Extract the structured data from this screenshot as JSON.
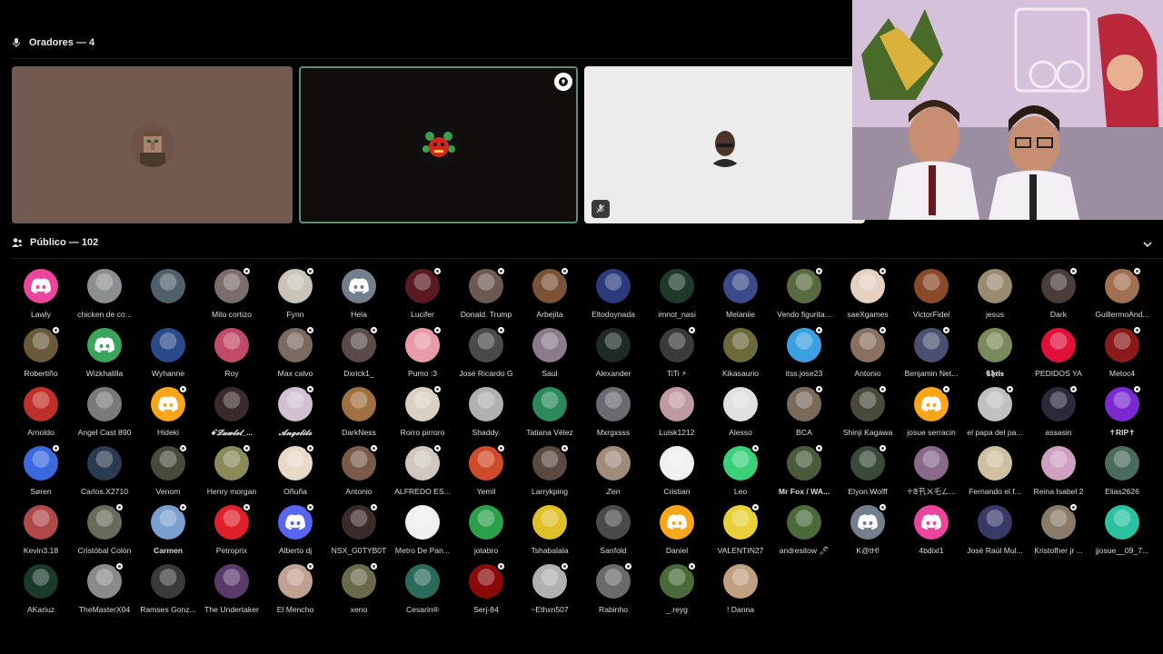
{
  "speakers": {
    "title": "Oradores — 4",
    "icon": "microphone-icon"
  },
  "audience": {
    "title": "Público — 102",
    "icon": "audience-icon",
    "collapse_icon": "chevron-down-icon"
  },
  "tiles": [
    {
      "id": "tile1",
      "avatar": "villager",
      "speaking": false,
      "moderator": false,
      "muted": false
    },
    {
      "id": "tile2",
      "avatar": "red-creature",
      "speaking": true,
      "moderator": true,
      "muted": false
    },
    {
      "id": "tile3",
      "avatar": "portrait",
      "speaking": false,
      "moderator": false,
      "muted": true
    }
  ],
  "colors": {
    "discord_pink": "#eb459e",
    "discord_green": "#3ba55c",
    "discord_orange": "#faa61a",
    "discord_gray": "#747f8d",
    "discord_blurple": "#5865f2",
    "speaking_border": "#5b8f6e"
  },
  "members": [
    [
      {
        "name": "Lawly",
        "color": "#eb459e",
        "type": "discord"
      },
      {
        "name": "chicken de co...",
        "color": "#8b8f90"
      },
      {
        "name": "",
        "color": "#50606a"
      },
      {
        "name": "Mito cortizo",
        "color": "#7a6d6b",
        "badge": true
      },
      {
        "name": "Fynn",
        "color": "#c9c3b8",
        "badge": true
      },
      {
        "name": "Hela",
        "color": "#747f8d",
        "type": "discord"
      },
      {
        "name": "Lucifer",
        "color": "#5a1a22",
        "badge": true
      },
      {
        "name": "Donald. Trump",
        "color": "#6c5a52",
        "badge": true
      },
      {
        "name": "Arbejita",
        "color": "#7b5238",
        "badge": true
      },
      {
        "name": "Eltodoynada",
        "color": "#2a3a7a"
      },
      {
        "name": "imnot_nasi",
        "color": "#1f3a28"
      },
      {
        "name": "Melaniie",
        "color": "#3a4a8a"
      },
      {
        "name": "Vendo figurita...",
        "color": "#5a6a40",
        "badge": true
      },
      {
        "name": "saeXgames",
        "color": "#e7d0c0",
        "badge": true
      },
      {
        "name": "VictorFidel",
        "color": "#8a4a2a"
      },
      {
        "name": "jesus",
        "color": "#9a8a70"
      },
      {
        "name": "Dark",
        "color": "#4a3c38",
        "badge": true
      },
      {
        "name": "GuillermoAnd...",
        "color": "#a07050",
        "badge": true
      }
    ],
    [
      {
        "name": "Robertiño",
        "color": "#6a5a3a",
        "badge": true
      },
      {
        "name": "Wizkhalilla",
        "color": "#3ba55c",
        "type": "discord"
      },
      {
        "name": "Wyhanne",
        "color": "#2a4a8a"
      },
      {
        "name": "Roy",
        "color": "#c04a6a"
      },
      {
        "name": "Max calvo",
        "color": "#7a6a60",
        "badge": true
      },
      {
        "name": "Dxrick1_",
        "color": "#5a4a4a",
        "badge": true
      },
      {
        "name": "Pumo :3",
        "color": "#e89aa8",
        "badge": true
      },
      {
        "name": "José Ricardo G",
        "color": "#4a4a4a",
        "badge": true
      },
      {
        "name": "Saul",
        "color": "#8a7a8a"
      },
      {
        "name": "Alexander",
        "color": "#1e2a24"
      },
      {
        "name": "TiTi ⚡",
        "color": "#3a3a3a",
        "badge": true
      },
      {
        "name": "Kikasaurio",
        "color": "#6a6a3a"
      },
      {
        "name": "itss.jose23",
        "color": "#3aa0e0",
        "badge": true
      },
      {
        "name": "Antonio",
        "color": "#8a7060",
        "badge": true
      },
      {
        "name": "Benjamin Net...",
        "color": "#4a5070",
        "badge": true
      },
      {
        "name": "𝕮𝖍𝖗𝖎𝖘",
        "color": "#7a8a5a",
        "style": "b"
      },
      {
        "name": "PEDIDOS YA",
        "color": "#e0103a"
      },
      {
        "name": "Metoc4",
        "color": "#8a1a1a",
        "badge": true
      }
    ],
    [
      {
        "name": "Arnoldo",
        "color": "#c0302a"
      },
      {
        "name": "Angel Cast 890",
        "color": "#7a7a7a"
      },
      {
        "name": "Hideki",
        "color": "#faa61a",
        "type": "discord",
        "badge": true
      },
      {
        "name": "ꗃ𝓛𝓪𝔀𝓵𝓮𝓽_...",
        "color": "#3a2a2a",
        "style": "bi"
      },
      {
        "name": "𝓐𝓷𝓰𝓮𝓵𝓲𝓽𝓸",
        "color": "#d0c0d0",
        "style": "bi",
        "badge": true
      },
      {
        "name": "DarkNess",
        "color": "#a07040"
      },
      {
        "name": "Rorro pirroro",
        "color": "#d8d0c0",
        "badge": true
      },
      {
        "name": "Shaddy.",
        "color": "#b0b0b0"
      },
      {
        "name": "Tatiana Vélez",
        "color": "#2a8a5a"
      },
      {
        "name": "Mxrgxsss",
        "color": "#6a6a70"
      },
      {
        "name": "Luisk1212",
        "color": "#c09aa0"
      },
      {
        "name": "Alesso",
        "color": "#e0e0e0"
      },
      {
        "name": "BCA",
        "color": "#7a6a5a",
        "badge": true
      },
      {
        "name": "Shinji Kagawa",
        "color": "#4a4a3a",
        "badge": true
      },
      {
        "name": "josue serracin",
        "color": "#faa61a",
        "type": "discord",
        "badge": true
      },
      {
        "name": "el papa del pa...",
        "color": "#c0c0c0",
        "badge": true
      },
      {
        "name": "assasin",
        "color": "#2a2a3a",
        "badge": true
      },
      {
        "name": "✝RIP✝",
        "color": "#7a2ad0",
        "style": "b",
        "badge": true
      }
    ],
    [
      {
        "name": "Søren",
        "color": "#3a6ae0",
        "badge": true
      },
      {
        "name": "Carlos.X2710",
        "color": "#2a3a50"
      },
      {
        "name": "Venom",
        "color": "#4a4a3a",
        "badge": true
      },
      {
        "name": "Henry morgan",
        "color": "#8a8a5a",
        "badge": true
      },
      {
        "name": "Oñuña",
        "color": "#e8d8c8",
        "badge": true
      },
      {
        "name": "Antonio",
        "color": "#7a5a4a",
        "badge": true
      },
      {
        "name": "ALFREDO ES...",
        "color": "#d0c8c0",
        "badge": true
      },
      {
        "name": "Yemil",
        "color": "#d04a2a",
        "badge": true
      },
      {
        "name": "Larrykping",
        "color": "#5a4a40",
        "badge": true
      },
      {
        "name": "Zen",
        "color": "#a08a7a",
        "style": "i"
      },
      {
        "name": "Cristian",
        "color": "#f0f0f0"
      },
      {
        "name": "Leo",
        "color": "#3ad07a",
        "badge": true
      },
      {
        "name": "Mr Fox / WA...",
        "color": "#4a5a3a",
        "style": "b",
        "badge": true
      },
      {
        "name": "Elyon.Wolff",
        "color": "#3a4a3a",
        "badge": true
      },
      {
        "name": "♱𝕾卂ㄨ乇ㄥ...",
        "color": "#8a6a8a"
      },
      {
        "name": "Fernando el f...",
        "color": "#d0c0a0"
      },
      {
        "name": "Reina Isabel 2",
        "color": "#d0a0c0"
      },
      {
        "name": "Elias2626",
        "color": "#4a6a5a"
      }
    ],
    [
      {
        "name": "Kevin3.18",
        "color": "#b04a4a"
      },
      {
        "name": "Cristóbal Colón",
        "color": "#6a6a5a",
        "badge": true
      },
      {
        "name": "Carmen",
        "color": "#7aa0d0",
        "style": "b",
        "badge": true
      },
      {
        "name": "Petroprix",
        "color": "#e0202a",
        "badge": true
      },
      {
        "name": "Alberto dj",
        "color": "#5865f2",
        "type": "discord",
        "badge": true
      },
      {
        "name": "NSX_G0TYB0T",
        "color": "#3a2a2a",
        "badge": true
      },
      {
        "name": "Metro De Pan...",
        "color": "#f0f0f0"
      },
      {
        "name": "jotabro",
        "color": "#2aa04a"
      },
      {
        "name": "Tshabalala",
        "color": "#e0c02a"
      },
      {
        "name": "Sanfold",
        "color": "#4a4a4a"
      },
      {
        "name": "Daniel",
        "color": "#faa61a",
        "type": "discord"
      },
      {
        "name": "VALENTIN27",
        "color": "#e8d03a",
        "badge": true
      },
      {
        "name": "andresitow 🖊",
        "color": "#4a6a3a"
      },
      {
        "name": "K@tH!",
        "color": "#747f8d",
        "type": "discord",
        "badge": true
      },
      {
        "name": "4bdixl1",
        "color": "#eb459e",
        "type": "discord"
      },
      {
        "name": "José Raúl Mul...",
        "color": "#3a3a6a"
      },
      {
        "name": "Kristofher jr ...",
        "color": "#8a7a6a",
        "badge": true
      },
      {
        "name": "jjosue__09_7...",
        "color": "#2ac0a0"
      }
    ],
    [
      {
        "name": "AKariuz",
        "color": "#1a3a2a"
      },
      {
        "name": "TheMasterX04",
        "color": "#8a8a8a",
        "badge": true
      },
      {
        "name": "Ramses Gonz...",
        "color": "#3a3a3a"
      },
      {
        "name": "The Undertaker",
        "color": "#5a3a6a"
      },
      {
        "name": "El Mencho",
        "color": "#c0a090",
        "badge": true
      },
      {
        "name": "xeno",
        "color": "#6a6a4a",
        "badge": true
      },
      {
        "name": "Cesarin®",
        "color": "#2a6a5a"
      },
      {
        "name": "Serj-84",
        "color": "#8a0a0a",
        "badge": true
      },
      {
        "name": "~Ethxn507",
        "color": "#b0b0b0",
        "badge": true
      },
      {
        "name": "Rabinho",
        "color": "#6a6a6a",
        "badge": true
      },
      {
        "name": "_.reyg",
        "color": "#4a6a3a",
        "badge": true
      },
      {
        "name": "! Danna",
        "color": "#c0a080"
      }
    ]
  ]
}
